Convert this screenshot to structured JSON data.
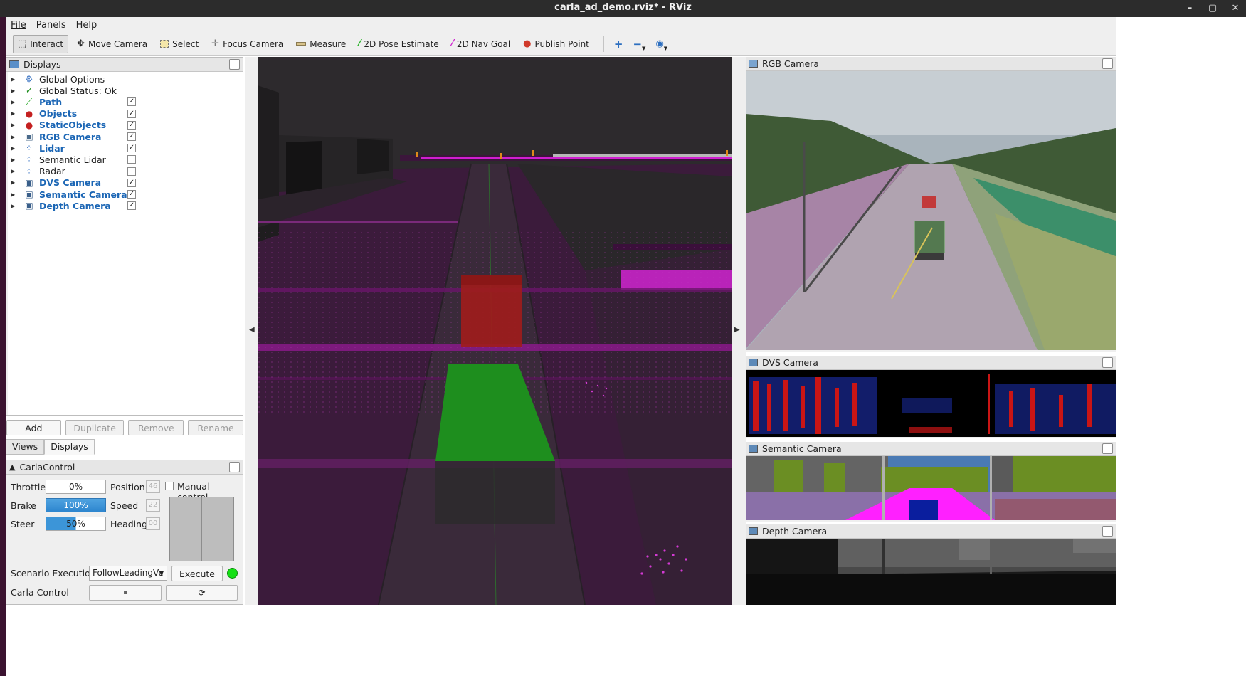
{
  "window": {
    "title": "carla_ad_demo.rviz* - RViz",
    "controls": [
      "–",
      "▢",
      "✕"
    ]
  },
  "menu": [
    "File",
    "Panels",
    "Help"
  ],
  "toolbar": {
    "tools": [
      {
        "label": "Interact",
        "icon": "cursor-icon",
        "active": true
      },
      {
        "label": "Move Camera",
        "icon": "move-camera-icon"
      },
      {
        "label": "Select",
        "icon": "select-icon"
      },
      {
        "label": "Focus Camera",
        "icon": "focus-camera-icon"
      },
      {
        "label": "Measure",
        "icon": "ruler-icon"
      },
      {
        "label": "2D Pose Estimate",
        "icon": "pose-arrow-icon"
      },
      {
        "label": "2D Nav Goal",
        "icon": "nav-arrow-icon"
      },
      {
        "label": "Publish Point",
        "icon": "map-pin-icon"
      }
    ]
  },
  "displays": {
    "title": "Displays",
    "items": [
      {
        "label": "Global Options",
        "icon": "gear-icon",
        "checked": null,
        "enabled": false
      },
      {
        "label": "Global Status: Ok",
        "icon": "check-icon",
        "checked": null,
        "enabled": false
      },
      {
        "label": "Path",
        "icon": "path-icon",
        "checked": true,
        "enabled": true
      },
      {
        "label": "Objects",
        "icon": "markers-icon",
        "checked": true,
        "enabled": true
      },
      {
        "label": "StaticObjects",
        "icon": "markers-icon",
        "checked": true,
        "enabled": true
      },
      {
        "label": "RGB Camera",
        "icon": "camera-icon",
        "checked": true,
        "enabled": true
      },
      {
        "label": "Lidar",
        "icon": "pointcloud-icon",
        "checked": true,
        "enabled": true
      },
      {
        "label": "Semantic Lidar",
        "icon": "pointcloud-icon",
        "checked": false,
        "enabled": false
      },
      {
        "label": "Radar",
        "icon": "pointcloud-icon",
        "checked": false,
        "enabled": false
      },
      {
        "label": "DVS Camera",
        "icon": "image-icon",
        "checked": true,
        "enabled": true
      },
      {
        "label": "Semantic Camera",
        "icon": "image-icon",
        "checked": true,
        "enabled": true
      },
      {
        "label": "Depth Camera",
        "icon": "image-icon",
        "checked": true,
        "enabled": true
      }
    ],
    "buttons": {
      "add": "Add",
      "duplicate": "Duplicate",
      "remove": "Remove",
      "rename": "Rename"
    }
  },
  "tabs": {
    "views": "Views",
    "displays": "Displays"
  },
  "carla_control": {
    "title": "CarlaControl",
    "throttle_label": "Throttle",
    "throttle_value": "0%",
    "throttle_fraction": 0,
    "brake_label": "Brake",
    "brake_value": "100%",
    "brake_fraction": 1.0,
    "steer_label": "Steer",
    "steer_value": "50%",
    "steer_fraction": 0.5,
    "position_label": "Position",
    "position_value": "46",
    "speed_label": "Speed",
    "speed_value": "22",
    "heading_label": "Heading",
    "heading_value": "00",
    "manual_label": "Manual control",
    "scenario_label": "Scenario Execution",
    "scenario_value": "FollowLeadingVe",
    "execute_label": "Execute",
    "status_color": "#00dd00",
    "carla_control_label": "Carla Control",
    "pause_icon": "⏸",
    "step_icon": "⟳"
  },
  "cameras": {
    "rgb": "RGB Camera",
    "dvs": "DVS Camera",
    "semantic": "Semantic Camera",
    "depth": "Depth Camera"
  },
  "colors": {
    "accent_label": "#1b66b5",
    "lidar": "#c81ec8",
    "ego_box": "#1f9a1f",
    "lead_box": "#b01c1c"
  }
}
